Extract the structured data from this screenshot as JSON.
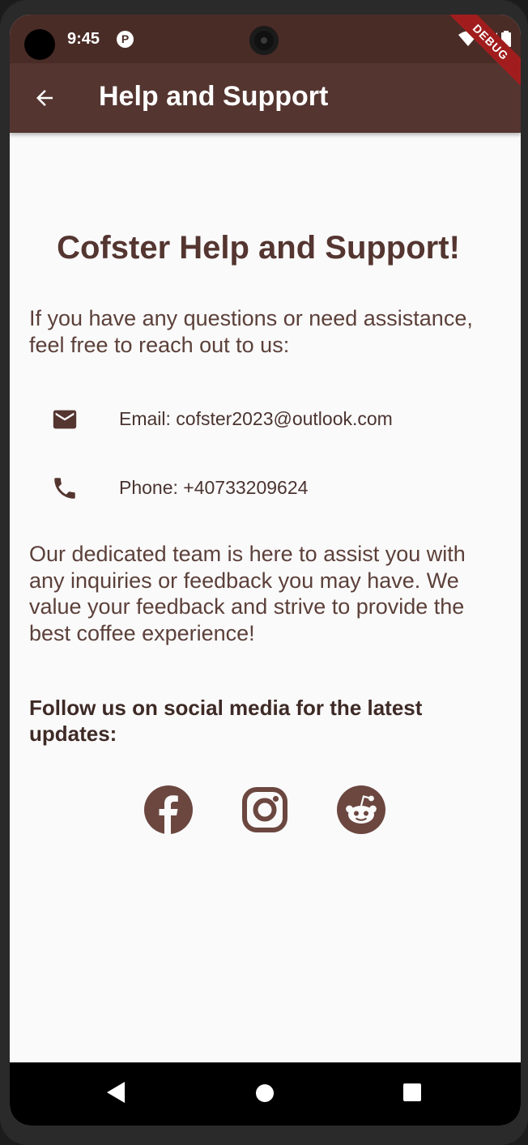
{
  "status_bar": {
    "time": "9:45",
    "app_icon_letter": "P"
  },
  "debug_banner": "DEBUG",
  "app_bar": {
    "title": "Help and Support",
    "back_icon": "arrow-back-icon"
  },
  "main": {
    "heading": "Cofster Help and Support!",
    "intro": " If you have any questions or need assistance, feel free to reach out to us:",
    "email": {
      "icon": "mail-icon",
      "text": "Email: cofster2023@outlook.com"
    },
    "phone": {
      "icon": "phone-icon",
      "text": "Phone: +40733209624"
    },
    "body": " Our dedicated team is here to assist you with any inquiries or feedback you may have. We value your feedback and strive to provide the best coffee experience!",
    "follow": " Follow us on social media for the latest updates:",
    "social": [
      "facebook-icon",
      "instagram-icon",
      "reddit-icon"
    ]
  },
  "nav_bar": [
    "back-triangle-icon",
    "home-circle-icon",
    "recents-square-icon"
  ],
  "colors": {
    "app_bar": "#543530",
    "status_bar": "#4a2c26",
    "accent_text": "#543530",
    "icon": "#6b4740"
  }
}
